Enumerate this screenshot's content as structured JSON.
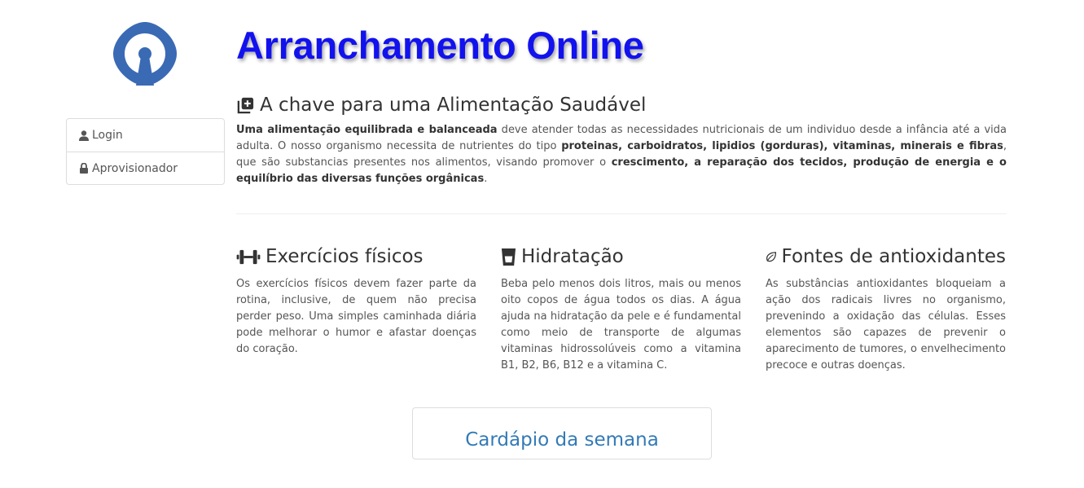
{
  "app": {
    "title": "Arranchamento Online",
    "logo_icon": "keyhole-logo-icon",
    "brand_color": "#1212ee",
    "logo_color": "#3a6ab4"
  },
  "sidebar": {
    "items": [
      {
        "label": "Login",
        "icon": "user-icon"
      },
      {
        "label": "Aprovisionador",
        "icon": "lock-icon"
      }
    ]
  },
  "intro": {
    "heading": "A chave para uma Alimentação Saudável",
    "icon": "plus-square-icon",
    "paragraph": [
      {
        "text": "Uma alimentação equilibrada e balanceada",
        "bold": true
      },
      {
        "text": " deve atender todas as necessidades nutricionais de um individuo desde a infância até a vida adulta. O nosso organismo necessita de nutrientes do tipo ",
        "bold": false
      },
      {
        "text": "proteinas, carboidratos, lipidios (gorduras), vitaminas, minerais e fibras",
        "bold": true
      },
      {
        "text": ", que são substancias presentes nos alimentos, visando promover o ",
        "bold": false
      },
      {
        "text": "crescimento, a reparação dos tecidos, produção de energia e o equilíbrio das diversas funções orgânicas",
        "bold": true
      },
      {
        "text": ".",
        "bold": false
      }
    ]
  },
  "features": [
    {
      "heading": "Exercícios físicos",
      "icon": "dumbbell-icon",
      "text": "Os exercícios físicos devem fazer parte da rotina, inclusive, de quem não precisa perder peso. Uma simples caminhada diária pode melhorar o humor e afastar doenças do coração."
    },
    {
      "heading": "Hidratação",
      "icon": "glass-icon",
      "text": "Beba pelo menos dois litros, mais ou menos oito copos de água todos os dias. A água ajuda na hidratação da pele e é fundamental como meio de transporte de algumas vitaminas hidrossolúveis como a vitamina B1, B2, B6, B12 e a vitamina C."
    },
    {
      "heading": "Fontes de antioxidantes",
      "icon": "leaf-icon",
      "text": "As substâncias antioxidantes bloqueiam a ação dos radicais livres no organismo, prevenindo a oxidação das células. Esses elementos são capazes de prevenir o aparecimento de tumores, o envelhecimento precoce e outras doenças."
    }
  ],
  "cta": {
    "label": "Cardápio da semana",
    "color": "#337ab7"
  }
}
